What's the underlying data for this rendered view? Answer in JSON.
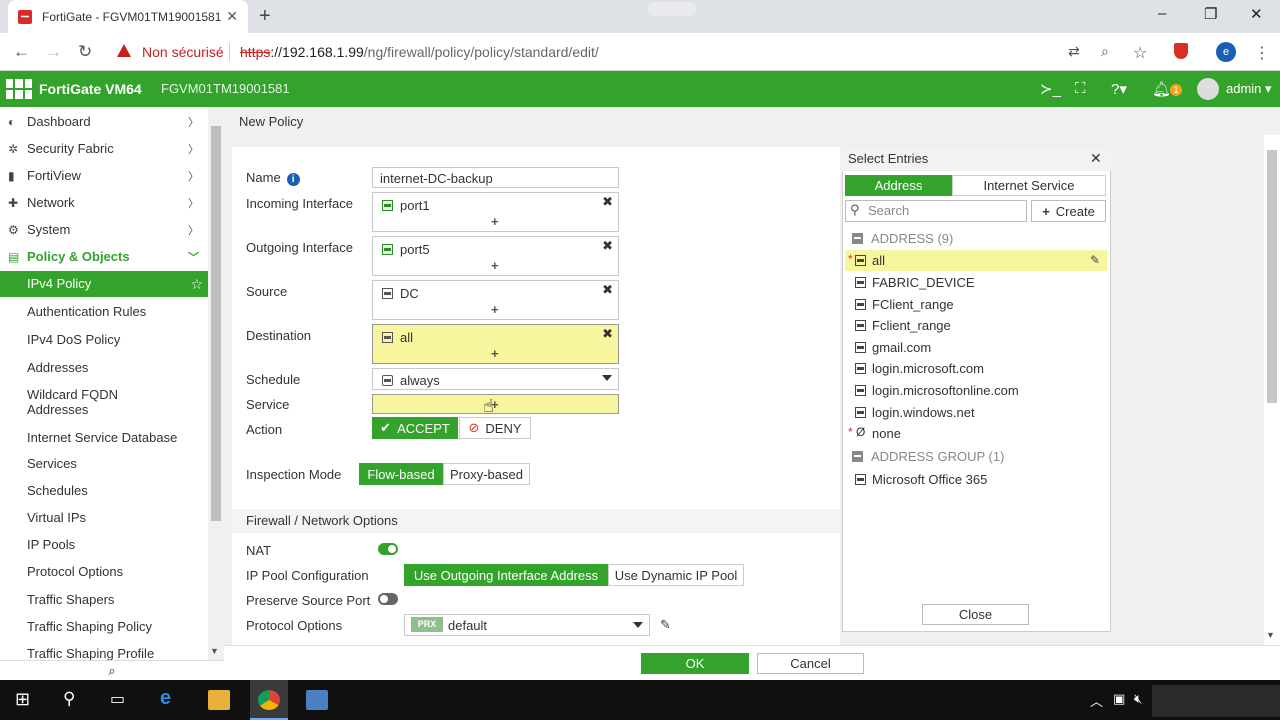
{
  "browser": {
    "tab_title": "FortiGate - FGVM01TM19001581",
    "new_tab": "+",
    "tab_close": "✕",
    "not_secure": "Non sécurisé",
    "url_scheme": "https",
    "url_host": "://192.168.1.99",
    "url_path": "/ng/firewall/policy/policy/standard/edit/",
    "profile_initial": "e",
    "win_minimize": "–",
    "win_restore": "❐",
    "win_close": "✕"
  },
  "header": {
    "product": "FortiGate VM64",
    "serial": "FGVM01TM19001581",
    "user": "admin",
    "notifications": "1"
  },
  "sidebar": {
    "items": [
      {
        "label": "Dashboard",
        "icon": "dashboard-icon"
      },
      {
        "label": "Security Fabric",
        "icon": "fabric-icon"
      },
      {
        "label": "FortiView",
        "icon": "eye-icon"
      },
      {
        "label": "Network",
        "icon": "network-icon"
      },
      {
        "label": "System",
        "icon": "gear-icon"
      },
      {
        "label": "Policy & Objects",
        "icon": "policy-icon"
      }
    ],
    "sub": [
      "IPv4 Policy",
      "Authentication Rules",
      "IPv4 DoS Policy",
      "Addresses",
      "Wildcard FQDN Addresses",
      "Internet Service Database",
      "Services",
      "Schedules",
      "Virtual IPs",
      "IP Pools",
      "Protocol Options",
      "Traffic Shapers",
      "Traffic Shaping Policy",
      "Traffic Shaping Profile"
    ]
  },
  "page": {
    "title": "New Policy"
  },
  "form": {
    "name_label": "Name",
    "name_value": "internet-DC-backup",
    "incoming_label": "Incoming Interface",
    "incoming_value": "port1",
    "outgoing_label": "Outgoing Interface",
    "outgoing_value": "port5",
    "source_label": "Source",
    "source_value": "DC",
    "destination_label": "Destination",
    "destination_value": "all",
    "schedule_label": "Schedule",
    "schedule_value": "always",
    "service_label": "Service",
    "action_label": "Action",
    "accept": "ACCEPT",
    "deny": "DENY",
    "inspection_label": "Inspection Mode",
    "flow_based": "Flow-based",
    "proxy_based": "Proxy-based",
    "section_firewall": "Firewall / Network Options",
    "nat_label": "NAT",
    "nat_enabled": true,
    "ippool_label": "IP Pool Configuration",
    "use_outgoing": "Use Outgoing Interface Address",
    "use_dynamic": "Use Dynamic IP Pool",
    "preserve_label": "Preserve Source Port",
    "preserve_enabled": false,
    "protocol_label": "Protocol Options",
    "protocol_badge": "PRX",
    "protocol_value": "default",
    "ok": "OK",
    "cancel": "Cancel"
  },
  "select_entries": {
    "title": "Select Entries",
    "tab_address": "Address",
    "tab_internet": "Internet Service",
    "search_placeholder": "Search",
    "create": "Create",
    "address_group_header": "ADDRESS (9)",
    "addresses": [
      "all",
      "FABRIC_DEVICE",
      "FClient_range",
      "Fclient_range",
      "gmail.com",
      "login.microsoft.com",
      "login.microsoftonline.com",
      "login.windows.net",
      "none"
    ],
    "group_header": "ADDRESS GROUP (1)",
    "groups": [
      "Microsoft Office 365"
    ],
    "close": "Close"
  },
  "colors": {
    "accent": "#33a32b",
    "highlight": "#f7f59e",
    "warning": "#c5221f"
  }
}
